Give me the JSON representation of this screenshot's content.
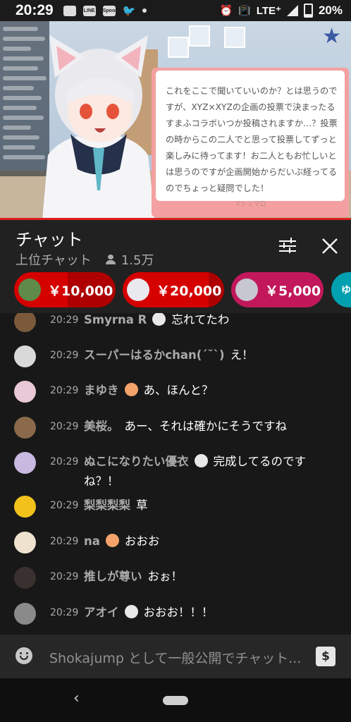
{
  "status_bar": {
    "time": "20:29",
    "icons": [
      "photo-icon",
      "line-app-icon",
      "spoon-app-icon",
      "twitter-icon",
      "dot-icon"
    ],
    "line_label": "LINE",
    "spoon_label": "Spoon",
    "network": "LTE⁺",
    "battery": "20%"
  },
  "video": {
    "card_text": "これをここで聞いていいのか？とは思うのですが、XYZ×XYZの企画の投票で決まったるすまふコラボいつか投稿されますか…？投票の時からこの二人でと思って投票してずっと楽しみに待ってます！お二人ともお忙しいとは思うのですが企画開始からだいぶ経ってるのでちょっと疑問でした！",
    "card_footer": "マシュマロ"
  },
  "chat_header": {
    "title": "チャット",
    "subtitle": "上位チャット",
    "viewers": "1.5万"
  },
  "super_chats": [
    {
      "amount": "￥10,000",
      "color": "#d50000",
      "avatar": "#5f8a4a"
    },
    {
      "amount": "￥20,000",
      "color": "#d50000",
      "avatar": "#e9e9ef"
    },
    {
      "amount": "￥5,000",
      "color": "#c2185b",
      "avatar": "#c7c7cf"
    },
    {
      "amount": "ゆ",
      "color": "#00a0b0",
      "avatar": ""
    }
  ],
  "messages": [
    {
      "time": "20:29",
      "author": "Smyrna R",
      "text": "忘れてたわ",
      "badge": true,
      "avatar": "#7a5a3a"
    },
    {
      "time": "20:29",
      "author": "スーパーはるかchan(ˊ˘ˋ)",
      "text": "え！",
      "badge": false,
      "avatar": "#d9d9d9"
    },
    {
      "time": "20:29",
      "author": "まゆき",
      "text": "あ、ほんと？",
      "badge": true,
      "avatar": "#e9c9d5"
    },
    {
      "time": "20:29",
      "author": "美桜。",
      "text": "あー、それは確かにそうですね",
      "badge": false,
      "avatar": "#8a6a4a"
    },
    {
      "time": "20:29",
      "author": "ぬこになりたい優衣",
      "text": "完成してるのですね？！",
      "badge": true,
      "avatar": "#c9b9e0"
    },
    {
      "time": "20:29",
      "author": "梨梨梨梨",
      "text": "草",
      "badge": false,
      "avatar": "#f2c21b"
    },
    {
      "time": "20:29",
      "author": "na",
      "text": "おおお",
      "badge": true,
      "avatar": "#efe3cf"
    },
    {
      "time": "20:29",
      "author": "推しが尊い",
      "text": "おぉ！",
      "badge": false,
      "avatar": "#3a3030"
    },
    {
      "time": "20:29",
      "author": "アオイ",
      "text": "おおお！！！",
      "badge": true,
      "avatar": "#8a8a8a"
    }
  ],
  "input": {
    "placeholder": "Shokajump として一般公開でチャット..."
  },
  "nav": {
    "back_icon": "‹"
  }
}
